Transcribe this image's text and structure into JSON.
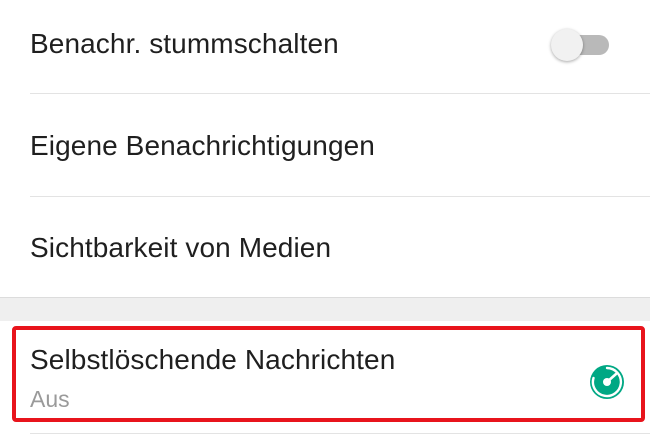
{
  "settings": {
    "mute": {
      "label": "Benachr. stummschalten",
      "enabled": false
    },
    "custom_notifications": {
      "label": "Eigene Benachrichtigungen"
    },
    "media_visibility": {
      "label": "Sichtbarkeit von Medien"
    },
    "disappearing_messages": {
      "label": "Selbstlöschende Nachrichten",
      "value": "Aus",
      "icon": "timer-icon"
    }
  },
  "colors": {
    "accent": "#00a884",
    "highlight": "#e8141c",
    "toggle_track_off": "#b9b9b9",
    "toggle_thumb_off": "#f1f1f1"
  }
}
